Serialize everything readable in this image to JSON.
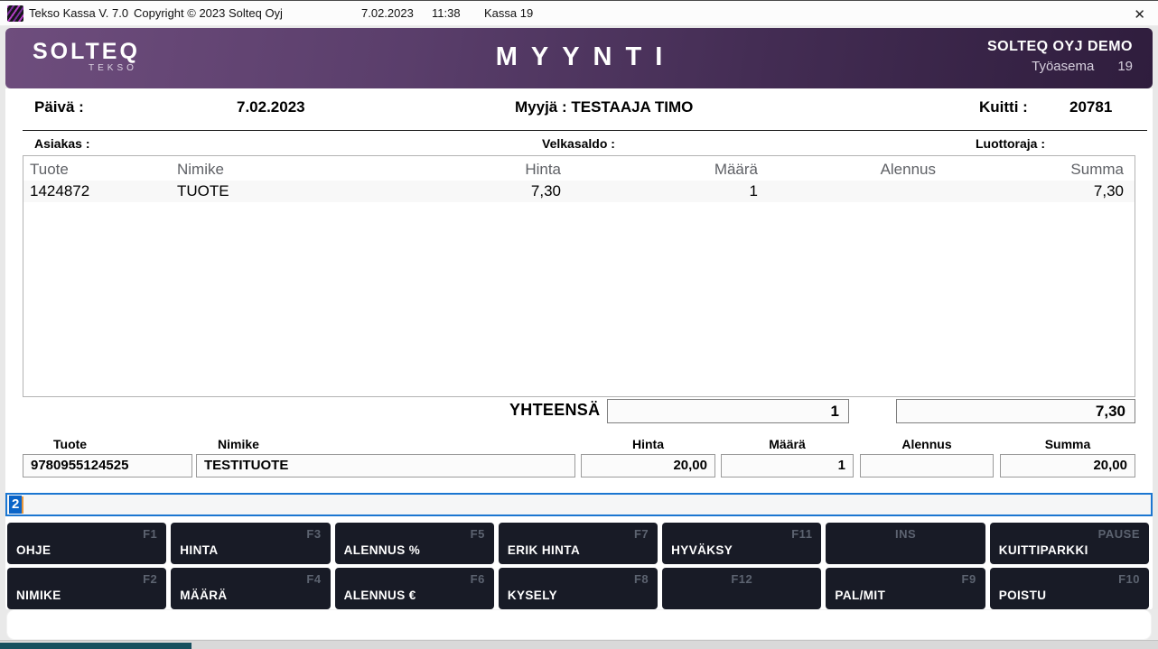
{
  "titlebar": {
    "app_title": "Tekso Kassa V. 7.0",
    "copyright": "Copyright © 2023 Solteq Oyj",
    "date": "7.02.2023",
    "time": "11:38",
    "register": "Kassa 19",
    "close_glyph": "✕"
  },
  "header": {
    "logo_primary": "SOLTEQ",
    "logo_secondary": "TEKSO",
    "title": "MYYNTI",
    "company": "SOLTEQ OYJ DEMO",
    "workstation_label": "Työasema",
    "workstation_value": "19",
    "colors": {
      "gradient_left": "#6e4d7d",
      "gradient_right": "#2f1d3d"
    }
  },
  "info": {
    "date_label": "Päivä :",
    "date_value": "7.02.2023",
    "seller": "Myyjä : TESTAAJA TIMO",
    "receipt_label": "Kuitti :",
    "receipt_value": "20781",
    "customer_label": "Asiakas :",
    "balance_label": "Velkasaldo :",
    "credit_label": "Luottoraja :"
  },
  "items_table": {
    "columns": [
      "Tuote",
      "Nimike",
      "Hinta",
      "Määrä",
      "Alennus",
      "Summa"
    ],
    "rows": [
      [
        "1424872",
        "TUOTE",
        "7,30",
        "1",
        "",
        "7,30"
      ]
    ]
  },
  "totals": {
    "label": "YHTEENSÄ",
    "quantity": "1",
    "amount": "7,30"
  },
  "entry": {
    "fields": [
      {
        "label": "Tuote",
        "value": "9780955124525"
      },
      {
        "label": "Nimike",
        "value": "TESTITUOTE"
      },
      {
        "label": "Hinta",
        "value": "20,00"
      },
      {
        "label": "Määrä",
        "value": "1"
      },
      {
        "label": "Alennus",
        "value": ""
      },
      {
        "label": "Summa",
        "value": "20,00"
      }
    ]
  },
  "command": {
    "value": "2"
  },
  "function_keys": {
    "row1": [
      {
        "label": "OHJE",
        "key": "F1"
      },
      {
        "label": "HINTA",
        "key": "F3"
      },
      {
        "label": "ALENNUS %",
        "key": "F5"
      },
      {
        "label": "ERIK HINTA",
        "key": "F7"
      },
      {
        "label": "HYVÄKSY",
        "key": "F11"
      },
      {
        "label": "",
        "key": "INS"
      },
      {
        "label": "KUITTIPARKKI",
        "key": "PAUSE"
      }
    ],
    "row2": [
      {
        "label": "NIMIKE",
        "key": "F2"
      },
      {
        "label": "MÄÄRÄ",
        "key": "F4"
      },
      {
        "label": "ALENNUS €",
        "key": "F6"
      },
      {
        "label": "KYSELY",
        "key": "F8"
      },
      {
        "label": "",
        "key": "F12"
      },
      {
        "label": "PAL/MIT",
        "key": "F9"
      },
      {
        "label": "POISTU",
        "key": "F10"
      }
    ]
  },
  "colors": {
    "button_bg": "#181b26",
    "command_border": "#1b76d1",
    "selection": "#0a64c8",
    "caret": "#e8973c",
    "teal_bar": "#16505f"
  }
}
